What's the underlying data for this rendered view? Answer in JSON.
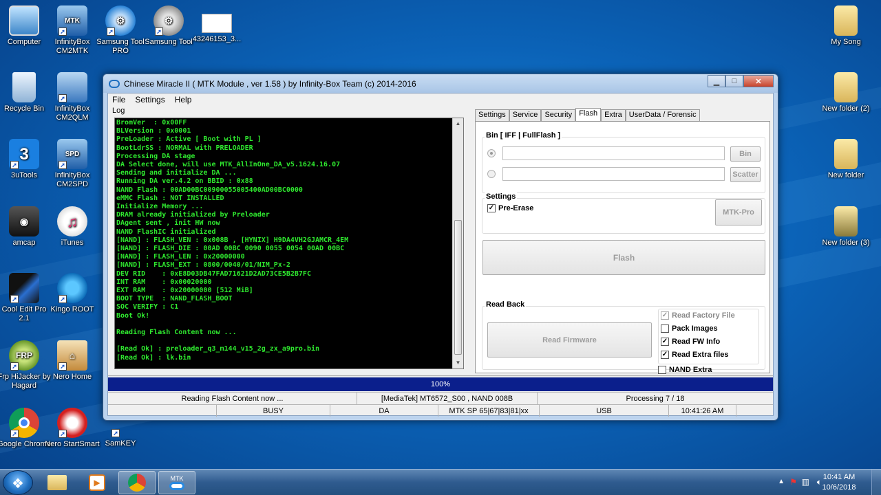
{
  "desktop": {
    "icons": [
      {
        "label": "Computer"
      },
      {
        "label": "InfinityBox CM2MTK",
        "badge": "MTK"
      },
      {
        "label": "Samsung Tool PRO"
      },
      {
        "label": "Samsung Tool"
      },
      {
        "label": "43246153_3..."
      },
      {
        "label": "Recycle Bin"
      },
      {
        "label": "InfinityBox CM2QLM"
      },
      {
        "label": "3uTools",
        "badge": "3"
      },
      {
        "label": "InfinityBox CM2SPD",
        "badge": "SPD"
      },
      {
        "label": "amcap"
      },
      {
        "label": "iTunes"
      },
      {
        "label": "Cool Edit Pro 2.1"
      },
      {
        "label": "Kingo ROOT"
      },
      {
        "label": "Frp HiJacker by Hagard",
        "badge": "FRP"
      },
      {
        "label": "Nero Home"
      },
      {
        "label": "Google Chrome"
      },
      {
        "label": "Nero StartSmart"
      },
      {
        "label": "SamKEY"
      },
      {
        "label": "My Song"
      },
      {
        "label": "New folder (2)"
      },
      {
        "label": "New folder"
      },
      {
        "label": "New folder (3)"
      }
    ]
  },
  "window": {
    "title": "Chinese Miracle II ( MTK Module , ver 1.58 ) by Infinity-Box Team (c) 2014-2016",
    "menu": [
      "File",
      "Settings",
      "Help"
    ],
    "log_label": "Log",
    "log_lines": [
      "BromVer  : 0x00FF",
      "BLVersion : 0x0001",
      "PreLoader : Active [ Boot with PL ]",
      "BootLdrSS : NORMAL with PRELOADER",
      "Processing DA stage",
      "DA Select done, will use MTK_AllInOne_DA_v5.1624.16.07",
      "Sending and initialize DA ...",
      "Running DA ver.4.2 on BBID : 0x88",
      "NAND Flash : 00AD00BC00900055005400AD00BC0000",
      "eMMC Flash : NOT INSTALLED",
      "Initialize Memory ...",
      "DRAM already initialized by Preloader",
      "DAgent sent , init HW now",
      "NAND FlashIC initialized",
      "[NAND] : FLASH_VEN : 0x008B , [HYNIX] H9DA4VH2GJAMCR_4EM",
      "[NAND] : FLASH_DIE : 00AD 00BC 0090 0055 0054 00AD 00BC",
      "[NAND] : FLASH_LEN : 0x20000000",
      "[NAND] : FLASH_EXT : 0800/0040/01/NIM_Px-2",
      "DEV RID    : 0xE8D03DB47FAD71621D2AD73CE5B2B7FC",
      "INT RAM    : 0x00020000",
      "EXT RAM    : 0x20000000 [512 MiB]",
      "BOOT TYPE  : NAND_FLASH_BOOT",
      "SOC VERIFY : C1",
      "Boot Ok!",
      "",
      "Reading Flash Content now ...",
      "",
      "[Read Ok] : preloader_q3_m144_v15_2g_zx_a9pro.bin",
      "[Read Ok] : lk.bin"
    ],
    "tabs": [
      "Settings",
      "Service",
      "Security",
      "Flash",
      "Extra",
      "UserData / Forensic"
    ],
    "active_tab": "Flash",
    "flash": {
      "bin_group": "Bin  [ IFF | FullFlash ]",
      "bin_button": "Bin",
      "scatter_button": "Scatter",
      "settings_group": "Settings",
      "pre_erase": "Pre-Erase",
      "mtk_pro_button": "MTK-Pro",
      "flash_button": "Flash",
      "readback_group": "Read Back",
      "read_firmware_button": "Read Firmware",
      "read_factory_file": "Read Factory File",
      "pack_images": "Pack Images",
      "read_fw_info": "Read FW Info",
      "read_extra_files": "Read Extra files",
      "nand_extra": "NAND Extra"
    },
    "progress": {
      "value": 100,
      "label": "100%",
      "color": "#0b1f8c"
    },
    "status1": [
      "Reading Flash Content now ...",
      "[MediaTek] MT6572_S00 , NAND 008B",
      "Processing 7 / 18"
    ],
    "status2": [
      "",
      "BUSY",
      "DA",
      "MTK SP 65|67|83|81|xx",
      "USB",
      "10:41:26 AM",
      ""
    ]
  },
  "taskbar": {
    "time": "10:41 AM",
    "date": "10/6/2018",
    "mtk_label": "MTK"
  }
}
